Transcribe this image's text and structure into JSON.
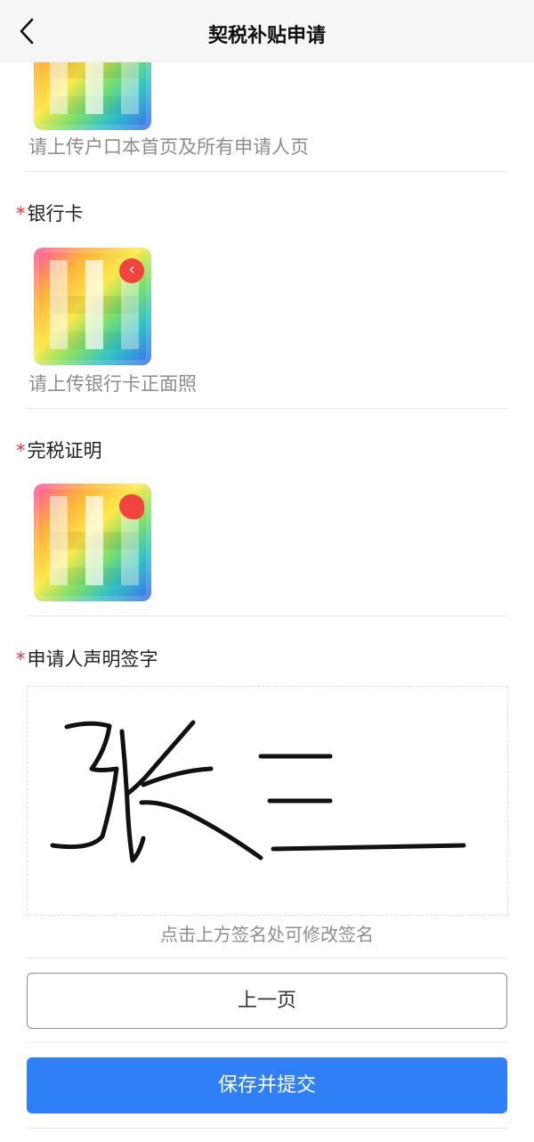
{
  "header": {
    "title": "契税补贴申请"
  },
  "sections": {
    "hukou": {
      "hint": "请上传户口本首页及所有申请人页"
    },
    "bank_card": {
      "label": "银行卡",
      "hint": "请上传银行卡正面照"
    },
    "tax_proof": {
      "label": "完税证明"
    },
    "signature": {
      "label": "申请人声明签字",
      "signed_text": "张三",
      "hint": "点击上方签名处可修改签名"
    }
  },
  "required_mark": "*",
  "buttons": {
    "prev": "上一页",
    "submit": "保存并提交"
  },
  "colors": {
    "primary": "#2f80f7",
    "required": "#e8323c",
    "hint": "#8d8d8d"
  },
  "icons": {
    "back": "chevron-left-icon",
    "image_badge": "chevron-left-icon"
  }
}
